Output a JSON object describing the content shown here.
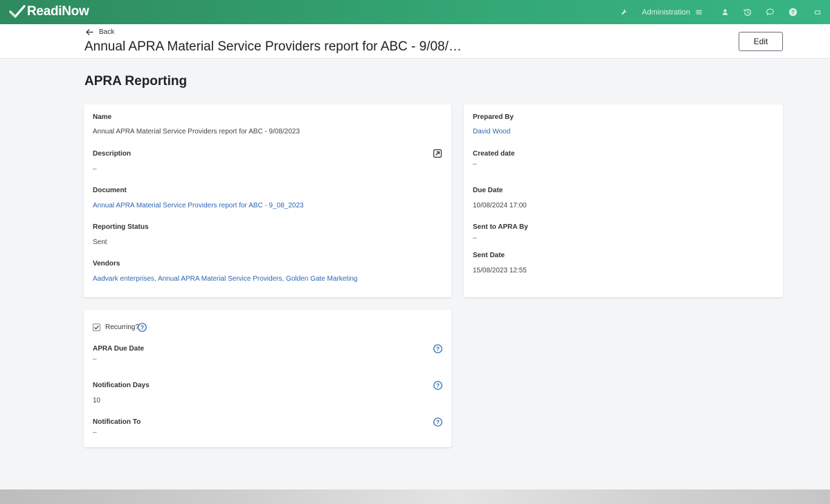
{
  "app": {
    "name": "ReadiNow"
  },
  "topnav": {
    "admin_label": "Administration"
  },
  "header": {
    "back_label": "Back",
    "title": "Annual APRA Material Service Providers report for ABC - 9/08/…",
    "edit_label": "Edit"
  },
  "section": {
    "title": "APRA Reporting"
  },
  "left_card": {
    "name_label": "Name",
    "name_value": "Annual APRA Material Service Providers report for ABC - 9/08/2023",
    "description_label": "Description",
    "description_value": "–",
    "document_label": "Document",
    "document_value": "Annual APRA Material Service Providers report for ABC - 9_08_2023",
    "status_label": "Reporting Status",
    "status_value": "Sent",
    "vendors_label": "Vendors",
    "vendors": [
      "Aadvark enterprises",
      "Annual APRA Material Service Providers",
      "Golden Gate Marketing"
    ]
  },
  "right_card": {
    "prepared_by_label": "Prepared By",
    "prepared_by_value": "David Wood",
    "created_label": "Created date",
    "created_value": "–",
    "due_label": "Due Date",
    "due_value": "10/08/2024 17:00",
    "sent_by_label": "Sent to APRA By",
    "sent_by_value": "–",
    "sent_date_label": "Sent Date",
    "sent_date_value": "15/08/2023 12:55"
  },
  "recurring_card": {
    "recurring_label": "Recurring?",
    "recurring_checked": true,
    "apra_due_label": "APRA Due Date",
    "apra_due_value": "–",
    "notif_days_label": "Notification Days",
    "notif_days_value": "10",
    "notif_to_label": "Notification To",
    "notif_to_value": "–"
  },
  "icons": {
    "logo": "check-logo-icon",
    "tools": "wrench-icon",
    "menu": "hamburger-icon",
    "user": "user-icon",
    "history": "history-icon",
    "chat": "chat-icon",
    "help": "help-icon",
    "window": "window-icon",
    "back": "arrow-left-icon",
    "expand": "expand-icon",
    "question": "question-circle-icon"
  },
  "colors": {
    "brand": "#34a876",
    "link": "#2f66b3"
  }
}
